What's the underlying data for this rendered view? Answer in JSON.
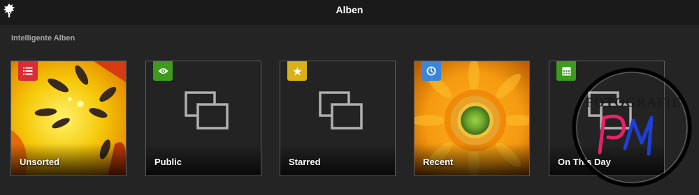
{
  "header": {
    "title": "Alben",
    "logo_icon": "lychee-logo-icon"
  },
  "section": {
    "title": "Intelligente Alben"
  },
  "albums": [
    {
      "label": "Unsorted",
      "badge_icon": "list-icon",
      "badge_color": "#d92c34",
      "cover": "yellow-flower-photo"
    },
    {
      "label": "Public",
      "badge_icon": "eye-icon",
      "badge_color": "#3d9a1c",
      "cover": "empty-album-placeholder"
    },
    {
      "label": "Starred",
      "badge_icon": "star-icon",
      "badge_color": "#d9b21b",
      "cover": "empty-album-placeholder"
    },
    {
      "label": "Recent",
      "badge_icon": "clock-icon",
      "badge_color": "#3b86d9",
      "cover": "orange-gerbera-photo"
    },
    {
      "label": "On This Day",
      "badge_icon": "calendar-icon",
      "badge_color": "#3d9a1c",
      "cover": "empty-album-placeholder"
    }
  ],
  "watermark": {
    "text_top": "FOTOGRAFIE",
    "monogram": "PM"
  },
  "colors": {
    "background": "#242424",
    "header_background": "#1a1a1a",
    "card_border": "#5c5c5c",
    "placeholder_stroke": "#b0b0b0"
  }
}
